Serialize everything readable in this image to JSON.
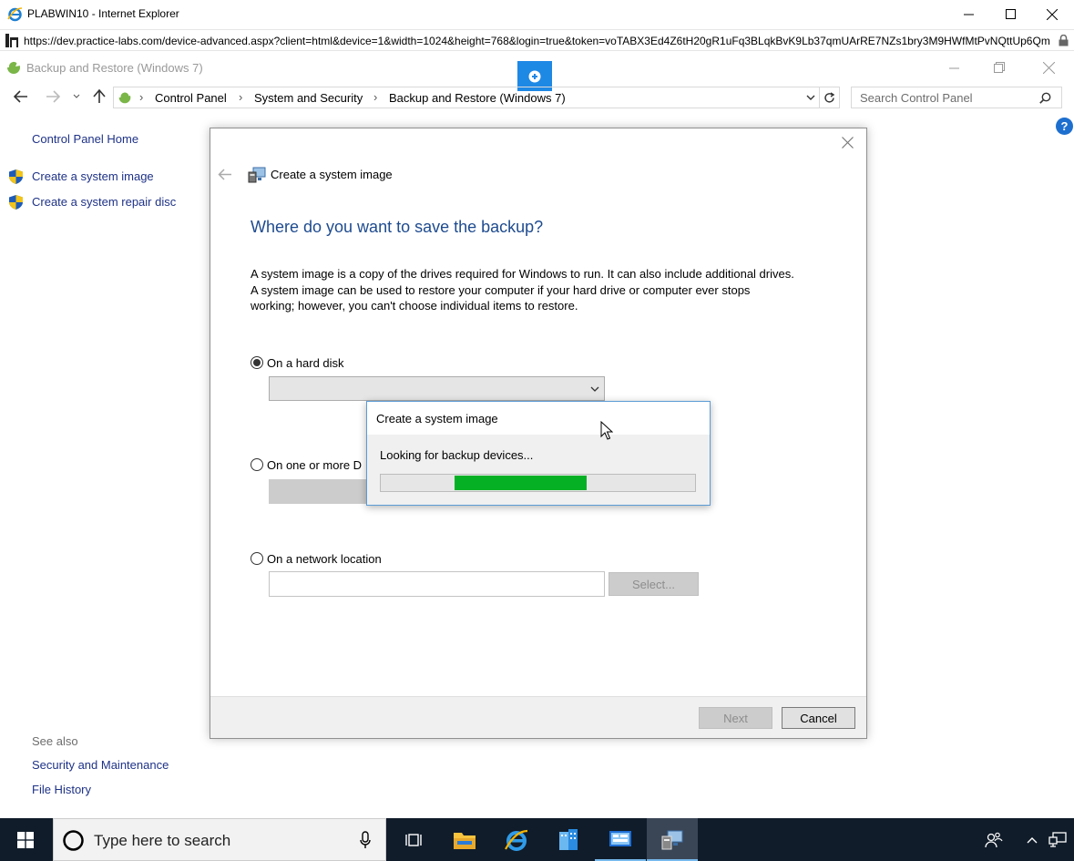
{
  "ie": {
    "title": "PLABWIN10 - Internet Explorer",
    "url": "https://dev.practice-labs.com/device-advanced.aspx?client=html&device=1&width=1024&height=768&login=true&token=voTABX3Ed4Z6tH20gR1uFq3BLqkBvK9Lb37qmUArRE7NZs1bry3M9HWfMtPvNQttUp6Qm"
  },
  "cp": {
    "window_title": "Backup and Restore (Windows 7)",
    "breadcrumb": [
      "Control Panel",
      "System and Security",
      "Backup and Restore (Windows 7)"
    ],
    "search_placeholder": "Search Control Panel",
    "left_pane": {
      "home": "Control Panel Home",
      "links": [
        "Create a system image",
        "Create a system repair disc"
      ],
      "see_also_label": "See also",
      "see_also": [
        "Security and Maintenance",
        "File History"
      ]
    }
  },
  "wizard": {
    "header": "Create a system image",
    "heading": "Where do you want to save the backup?",
    "description": "A system image is a copy of the drives required for Windows to run. It can also include additional drives. A system image can be used to restore your computer if your hard drive or computer ever stops working; however, you can't choose individual items to restore.",
    "option_hard_disk": "On a hard disk",
    "option_dvd": "On one or more D",
    "option_network": "On a network location",
    "select_button": "Select...",
    "next_button": "Next",
    "cancel_button": "Cancel",
    "selected_option": "hard_disk"
  },
  "popup": {
    "title": "Create a system image",
    "status": "Looking for backup devices...",
    "progress_start": 0.235,
    "progress_end": 0.655
  },
  "taskbar": {
    "search_placeholder": "Type here to search"
  },
  "colors": {
    "link": "#1e3287",
    "heading": "#1e4b8f",
    "progress": "#06b025",
    "taskbar": "#101c2a"
  }
}
